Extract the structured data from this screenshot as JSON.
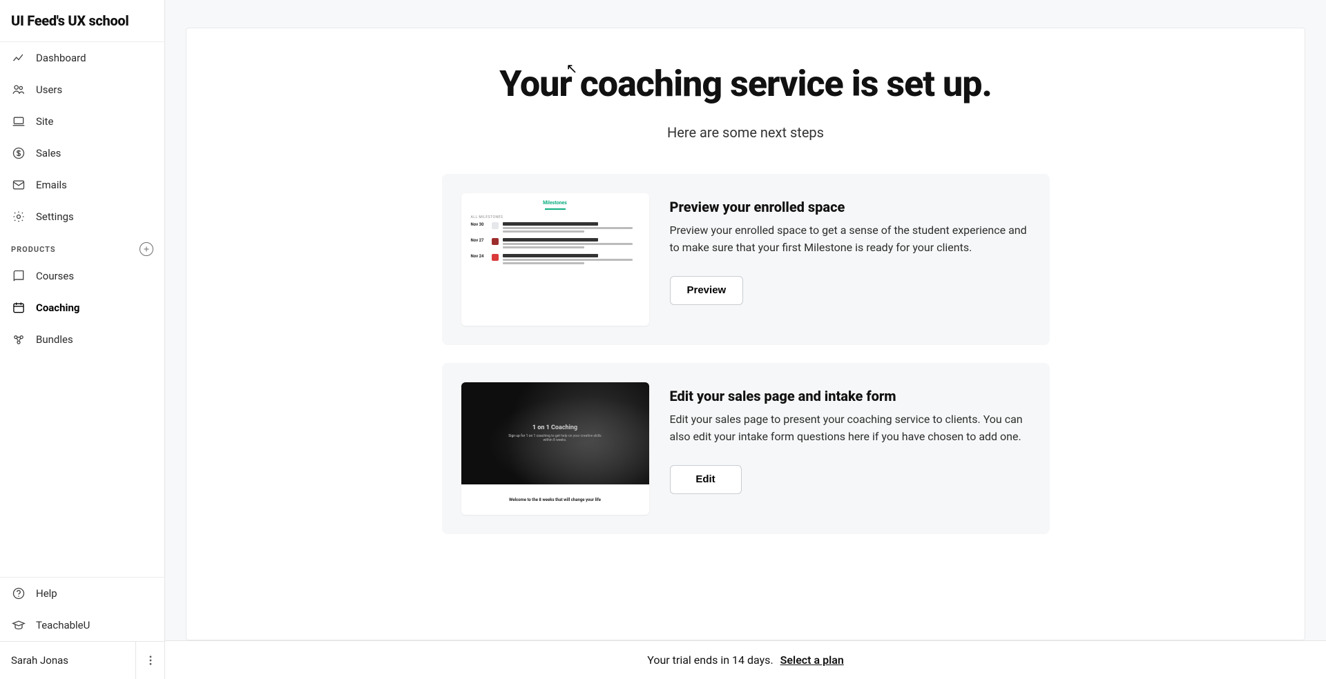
{
  "brand": {
    "title": "UI Feed's UX school"
  },
  "sidebar": {
    "nav": [
      {
        "label": "Dashboard",
        "icon": "chart-line-icon",
        "active": false
      },
      {
        "label": "Users",
        "icon": "users-icon",
        "active": false
      },
      {
        "label": "Site",
        "icon": "laptop-icon",
        "active": false
      },
      {
        "label": "Sales",
        "icon": "dollar-circle-icon",
        "active": false
      },
      {
        "label": "Emails",
        "icon": "mail-icon",
        "active": false
      },
      {
        "label": "Settings",
        "icon": "gear-icon",
        "active": false
      }
    ],
    "products_header": "PRODUCTS",
    "products": [
      {
        "label": "Courses",
        "icon": "book-icon",
        "active": false
      },
      {
        "label": "Coaching",
        "icon": "calendar-icon",
        "active": true
      },
      {
        "label": "Bundles",
        "icon": "bundle-icon",
        "active": false
      }
    ],
    "bottom": [
      {
        "label": "Help",
        "icon": "help-circle-icon"
      },
      {
        "label": "TeachableU",
        "icon": "graduation-icon"
      }
    ],
    "user_name": "Sarah Jonas"
  },
  "main": {
    "title": "Your coaching service is set up.",
    "subtitle": "Here are some next steps",
    "cards": [
      {
        "title": "Preview your enrolled space",
        "desc": "Preview your enrolled space to get a sense of the student experience and to make sure that your first Milestone is ready for your clients.",
        "button": "Preview",
        "thumb": {
          "heading": "Milestones",
          "all_label": "ALL MILESTONES",
          "rows": [
            {
              "date": "Nov 30",
              "color": "#e5e7eb",
              "title_w": "68%",
              "line2_w": "95%",
              "line3_w": "55%"
            },
            {
              "date": "Nov 27",
              "color": "#9d2d2d",
              "title_w": "52%",
              "line2_w": "92%",
              "line3_w": "70%"
            },
            {
              "date": "Nov 24",
              "color": "#d93a3a",
              "title_w": "40%",
              "line2_w": "90%",
              "line3_w": "48%"
            }
          ]
        }
      },
      {
        "title": "Edit your sales page and intake form",
        "desc": "Edit your sales page to present your coaching service to clients. You can also edit your intake form questions here if you have chosen to add one.",
        "button": "Edit",
        "thumb": {
          "hero_title": "1 on 1 Coaching",
          "hero_sub": "Sign up for 1 on 1 coaching to get help on your creative skills within 8 weeks.",
          "below": "Welcome to the 8 weeks that will change your life"
        }
      }
    ]
  },
  "trial": {
    "text": "Your trial ends in 14 days.",
    "link": "Select a plan"
  }
}
